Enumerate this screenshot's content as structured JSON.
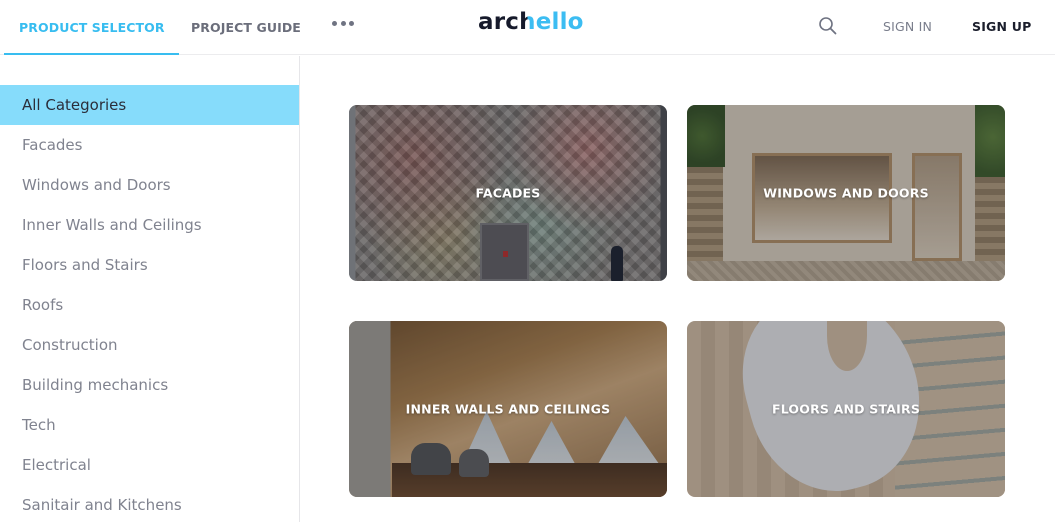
{
  "header": {
    "tabs": [
      {
        "label": "PRODUCT SELECTOR",
        "active": true
      },
      {
        "label": "PROJECT GUIDE",
        "active": false
      }
    ],
    "more_icon": "more-horizontal-icon",
    "logo": {
      "part1": "arc",
      "part2": "hello",
      "part1_prefix_h": "h"
    },
    "logo_text_dark": "arc",
    "logo_text_mixed_h": "h",
    "logo_text_light": "ello",
    "search_icon": "search-icon",
    "sign_in": "SIGN IN",
    "sign_up": "SIGN UP"
  },
  "colors": {
    "accent": "#38bdf0",
    "active_category_bg": "#86dcfb",
    "logo_dark": "#161a2b"
  },
  "sidebar": {
    "categories": [
      {
        "label": "All Categories",
        "active": true
      },
      {
        "label": "Facades"
      },
      {
        "label": "Windows and Doors"
      },
      {
        "label": "Inner Walls and Ceilings"
      },
      {
        "label": "Floors and Stairs"
      },
      {
        "label": "Roofs"
      },
      {
        "label": "Construction"
      },
      {
        "label": "Building mechanics"
      },
      {
        "label": "Tech"
      },
      {
        "label": "Electrical"
      },
      {
        "label": "Sanitair and Kitchens"
      }
    ]
  },
  "main": {
    "cards": [
      {
        "label": "FACADES"
      },
      {
        "label": "WINDOWS AND DOORS"
      },
      {
        "label": "INNER WALLS AND CEILINGS"
      },
      {
        "label": "FLOORS AND STAIRS"
      }
    ]
  }
}
